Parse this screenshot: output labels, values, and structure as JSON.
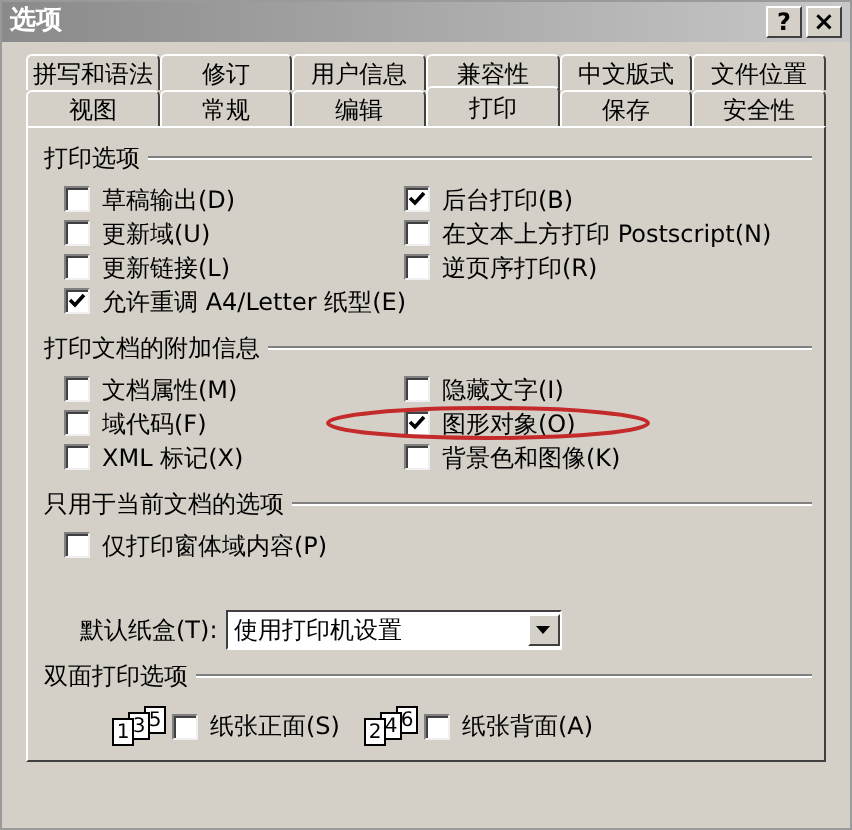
{
  "window": {
    "title": "选项",
    "buttons": [
      {
        "kind": "help",
        "label": "?"
      },
      {
        "kind": "close",
        "label": "×"
      }
    ]
  },
  "tab_rows": [
    [
      {
        "label": "拼写和语法",
        "selected": false
      },
      {
        "label": "修订",
        "selected": false
      },
      {
        "label": "用户信息",
        "selected": false
      },
      {
        "label": "兼容性",
        "selected": false
      },
      {
        "label": "中文版式",
        "selected": false
      },
      {
        "label": "文件位置",
        "selected": false
      }
    ],
    [
      {
        "label": "视图",
        "selected": false
      },
      {
        "label": "常规",
        "selected": false
      },
      {
        "label": "编辑",
        "selected": false
      },
      {
        "label": "打印",
        "selected": true
      },
      {
        "label": "保存",
        "selected": false
      },
      {
        "label": "安全性",
        "selected": false
      }
    ]
  ],
  "sections": [
    {
      "title": "打印选项",
      "left": [
        {
          "label": "草稿输出(D)",
          "checked": false
        },
        {
          "label": "更新域(U)",
          "checked": false
        },
        {
          "label": "更新链接(L)",
          "checked": false
        },
        {
          "label": "允许重调 A4/Letter 纸型(E)",
          "checked": true
        }
      ],
      "right": [
        {
          "label": "后台打印(B)",
          "checked": true
        },
        {
          "label": "在文本上方打印 Postscript(N)",
          "checked": false
        },
        {
          "label": "逆页序打印(R)",
          "checked": false
        }
      ]
    },
    {
      "title": "打印文档的附加信息",
      "left": [
        {
          "label": "文档属性(M)",
          "checked": false
        },
        {
          "label": "域代码(F)",
          "checked": false
        },
        {
          "label": "XML 标记(X)",
          "checked": false
        }
      ],
      "right": [
        {
          "label": "隐藏文字(I)",
          "checked": false
        },
        {
          "label": "图形对象(O)",
          "checked": true,
          "circled": true
        },
        {
          "label": "背景色和图像(K)",
          "checked": false
        }
      ]
    },
    {
      "title": "只用于当前文档的选项",
      "left": [
        {
          "label": "仅打印窗体域内容(P)",
          "checked": false
        }
      ]
    }
  ],
  "tray": {
    "label": "默认纸盒(T):",
    "value": "使用打印机设置"
  },
  "duplex": {
    "title": "双面打印选项",
    "items": [
      {
        "pages": [
          "1",
          "3",
          "5"
        ],
        "label": "纸张正面(S)",
        "checked": false
      },
      {
        "pages": [
          "2",
          "4",
          "6"
        ],
        "label": "纸张背面(A)",
        "checked": false
      }
    ]
  }
}
